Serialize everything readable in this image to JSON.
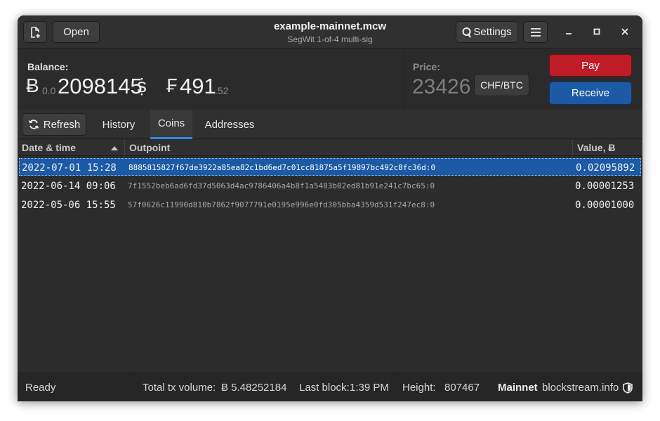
{
  "window": {
    "title": "example-mainnet.mcw",
    "subtitle": "SegWit 1-of-4 multi-sig"
  },
  "header": {
    "open_label": "Open",
    "settings_label": "Settings"
  },
  "balance": {
    "label": "Balance:",
    "btc_symbol": "Ƀ",
    "btc_prefix": "0.0",
    "btc_main": "2098145",
    "btc_unit": "ṩ",
    "fiat_symbol": "₣",
    "fiat_main": "491",
    "fiat_cents": ".52"
  },
  "price": {
    "label": "Price:",
    "value": "23426",
    "pair_button": "CHF/BTC"
  },
  "actions": {
    "pay_label": "Pay",
    "receive_label": "Receive"
  },
  "tabs": {
    "refresh_label": "Refresh",
    "history": "History",
    "coins": "Coins",
    "addresses": "Addresses",
    "active": "Coins"
  },
  "table": {
    "columns": {
      "date": "Date & time",
      "outpoint": "Outpoint",
      "value": "Value, Ƀ"
    },
    "rows": [
      {
        "date": "2022-07-01 15:28",
        "outpoint": "8885815827f67de3922a85ea82c1bd6ed7c01cc81875a5f19897bc492c8fc36d:0",
        "value": "0.02095892"
      },
      {
        "date": "2022-06-14 09:06",
        "outpoint": "7f1552beb6ad6fd37d5063d4ac9786406a4b8f1a5483b02ed81b91e241c7bc65:0",
        "value": "0.00001253"
      },
      {
        "date": "2022-05-06 15:55",
        "outpoint": "57f0626c11990d810b7862f9077791e0195e996e0fd305bba4359d531f247ec8:0",
        "value": "0.00001000"
      }
    ]
  },
  "status": {
    "state": "Ready",
    "volume_label": "Total tx volume:",
    "volume_value": "Ƀ 5.48252184",
    "last_block_label": "Last block:",
    "last_block_value": "1:39 PM",
    "height_label": "Height:",
    "height_value": "807467",
    "network": "Mainnet",
    "provider": "blockstream.info"
  },
  "colors": {
    "accent": "#3584e4",
    "pay": "#c01c28",
    "receive": "#1c5aa6",
    "selected_row": "#1c5aa6"
  }
}
